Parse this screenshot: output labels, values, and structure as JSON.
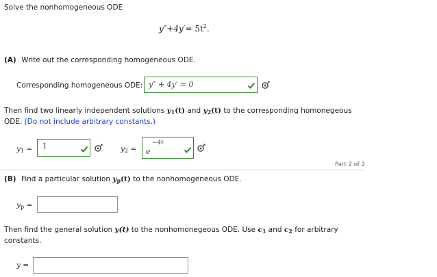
{
  "problem": {
    "intro": "Solve the nonhomogeneous ODE",
    "equation_lhs": "y″+4y′",
    "equation_rhs": "= 5t",
    "equation_exp": "2",
    "equation_end": "."
  },
  "partA": {
    "label": "(A)",
    "text": "Write out the corresponding homogeneous ODE.",
    "homog_label": "Corresponding homogeneous ODE:",
    "homog_value": "y″ + 4y′ = 0",
    "instr1_prefix": "Then find two linearly independent solutions",
    "instr1_y": "y",
    "instr1_sub1": "1",
    "instr1_t": "(t)",
    "instr1_and": "and",
    "instr1_sub2": "2",
    "instr1_suffix": "to the corresponding homonegeous",
    "instr2_prefix": "ODE.",
    "instr2_note": "(Do not include arbitrary constants.)",
    "y1_label": "y",
    "y1_sub": "1",
    "y1_value": "1",
    "y2_label": "y",
    "y2_sub": "2",
    "y2_base": "e",
    "y2_exp": "−4t",
    "part_indicator": "Part 2 of 2"
  },
  "partB": {
    "label": "(B)",
    "text_prefix": "Find a particular solution",
    "text_y": "y",
    "text_sub": "p",
    "text_t": "(t)",
    "text_suffix": "to the nonhomogeneous ODE.",
    "yp_label": "y",
    "yp_sub": "p",
    "yp_value": "",
    "general_prefix": "Then find the general solution",
    "general_y": "y(t)",
    "general_mid": "to the nonhomonegeous ODE. Use",
    "c": "c",
    "c1_sub": "1",
    "and": "and",
    "c2_sub": "2",
    "general_suffix": "for arbitrary",
    "general_line2": "constants.",
    "y_label": "y",
    "y_value": ""
  },
  "colors": {
    "correct_border": "#2e8a26",
    "note_blue": "#1a3fd1",
    "check": "#2e8a26"
  },
  "icons": [
    "checkmark-icon",
    "gear-icon"
  ]
}
